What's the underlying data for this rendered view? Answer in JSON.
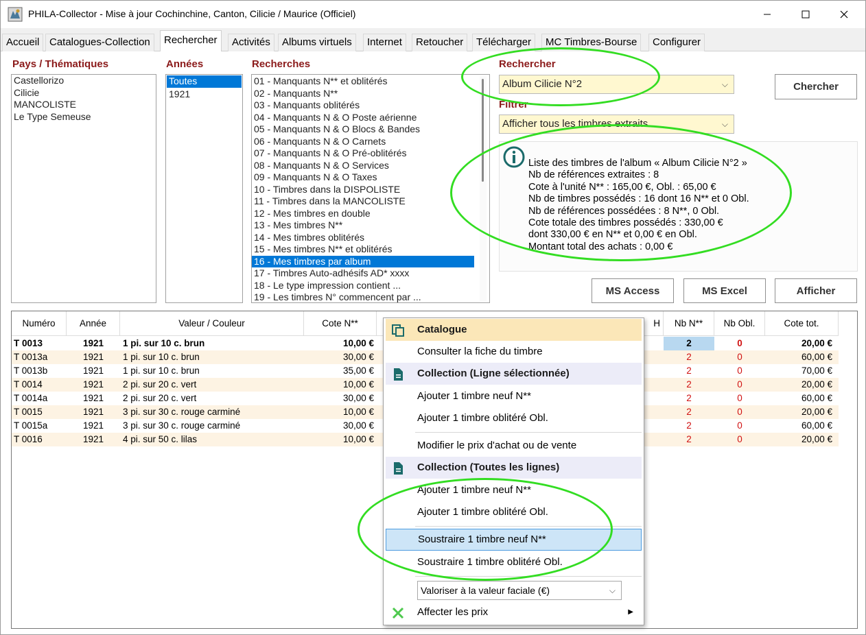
{
  "window": {
    "title": "PHILA-Collector - Mise à jour Cochinchine, Canton, Cilicie / Maurice (Officiel)"
  },
  "tabs": [
    {
      "label": "Accueil"
    },
    {
      "label": "Catalogues-Collection"
    },
    {
      "label": "Rechercher"
    },
    {
      "label": "Activités"
    },
    {
      "label": "Albums virtuels"
    },
    {
      "label": "Internet"
    },
    {
      "label": "Retoucher"
    },
    {
      "label": "Télécharger"
    },
    {
      "label": "MC Timbres-Bourse"
    },
    {
      "label": "Configurer"
    }
  ],
  "filters": {
    "pays_label": "Pays / Thématiques",
    "pays": [
      "Castellorizo",
      "Cilicie",
      "MANCOLISTE",
      "Le Type Semeuse"
    ],
    "annees_label": "Années",
    "annees": [
      "Toutes",
      "1921"
    ],
    "recherches_label": "Recherches",
    "recherches": [
      "01 - Manquants N** et oblitérés",
      "02 - Manquants N**",
      "03 - Manquants oblitérés",
      "04 - Manquants N & O Poste aérienne",
      "05 - Manquants N & O Blocs & Bandes",
      "06 - Manquants N & O Carnets",
      "07 - Manquants N & O Pré-oblitérés",
      "08 - Manquants N & O Services",
      "09 - Manquants N & O Taxes",
      "10 - Timbres dans la DISPOLISTE",
      "11 - Timbres dans la MANCOLISTE",
      "12 - Mes timbres en double",
      "13 - Mes timbres N**",
      "14 - Mes timbres oblitérés",
      "15 - Mes timbres N** et oblitérés",
      "16 - Mes timbres par album",
      "17 - Timbres Auto-adhésifs AD* xxxx",
      "18 - Le type impression contient ...",
      "19 - Les timbres N° commencent par ..."
    ],
    "rechercher_label": "Rechercher",
    "rechercher_value": "Album Cilicie N°2",
    "filtrer_label": "Filtrer",
    "filtrer_value": "Afficher tous les timbres extraits"
  },
  "buttons": {
    "chercher": "Chercher",
    "ms_access": "MS Access",
    "ms_excel": "MS Excel",
    "afficher": "Afficher"
  },
  "info": {
    "lines": [
      "Liste des timbres de l'album « Album Cilicie N°2 »",
      "Nb de références extraites : 8",
      "Cote à l'unité N** : 165,00 €, Obl. : 65,00 €",
      "Nb de timbres possédés : 16 dont 16 N** et 0 Obl.",
      "Nb de références possédées : 8 N**, 0 Obl.",
      "Cote totale des timbres possédés : 330,00 €",
      "dont 330,00 € en N** et 0,00 € en Obl.",
      "Montant total des achats : 0,00 €"
    ]
  },
  "grid": {
    "headers": {
      "numero": "Numéro",
      "annee": "Année",
      "valeur": "Valeur / Couleur",
      "cote_n": "Cote N**",
      "h_partial": "H",
      "nb_n": "Nb N**",
      "nb_obl": "Nb Obl.",
      "cote_tot": "Cote tot."
    },
    "rows": [
      {
        "numero": "T 0013",
        "annee": "1921",
        "valeur": "1 pi. sur 10 c. brun",
        "cote": "10,00 €",
        "nb_n": "2",
        "nb_obl": "0",
        "tot": "20,00 €"
      },
      {
        "numero": "T 0013a",
        "annee": "1921",
        "valeur": "1 pi. sur 10 c. brun",
        "cote": "30,00 €",
        "nb_n": "2",
        "nb_obl": "0",
        "tot": "60,00 €"
      },
      {
        "numero": "T 0013b",
        "annee": "1921",
        "valeur": "1 pi. sur 10 c. brun",
        "cote": "35,00 €",
        "nb_n": "2",
        "nb_obl": "0",
        "tot": "70,00 €"
      },
      {
        "numero": "T 0014",
        "annee": "1921",
        "valeur": "2 pi. sur 20 c. vert",
        "cote": "10,00 €",
        "nb_n": "2",
        "nb_obl": "0",
        "tot": "20,00 €"
      },
      {
        "numero": "T 0014a",
        "annee": "1921",
        "valeur": "2 pi. sur 20 c. vert",
        "cote": "30,00 €",
        "nb_n": "2",
        "nb_obl": "0",
        "tot": "60,00 €"
      },
      {
        "numero": "T 0015",
        "annee": "1921",
        "valeur": "3 pi. sur 30 c. rouge carminé",
        "cote": "10,00 €",
        "nb_n": "2",
        "nb_obl": "0",
        "tot": "20,00 €"
      },
      {
        "numero": "T 0015a",
        "annee": "1921",
        "valeur": "3 pi. sur 30 c. rouge carminé",
        "cote": "30,00 €",
        "nb_n": "2",
        "nb_obl": "0",
        "tot": "60,00 €"
      },
      {
        "numero": "T 0016",
        "annee": "1921",
        "valeur": "4 pi. sur 50 c. lilas",
        "cote": "10,00 €",
        "nb_n": "2",
        "nb_obl": "0",
        "tot": "20,00 €"
      }
    ]
  },
  "context_menu": {
    "catalogue": "Catalogue",
    "consulter": "Consulter la fiche du timbre",
    "collection_sel": "Collection (Ligne sélectionnée)",
    "ajouter_neuf_1": "Ajouter 1 timbre neuf N**",
    "ajouter_obl_1": "Ajouter 1 timbre oblitéré Obl.",
    "modifier_prix": "Modifier le prix d'achat ou de vente",
    "collection_all": "Collection (Toutes les lignes)",
    "ajouter_neuf_2": "Ajouter 1 timbre neuf N**",
    "ajouter_obl_2": "Ajouter 1 timbre oblitéré Obl.",
    "soustraire_neuf": "Soustraire 1 timbre neuf N**",
    "soustraire_obl": "Soustraire 1 timbre oblitéré Obl.",
    "valoriser": "Valoriser à la valeur faciale (€)",
    "affecter": "Affecter les prix"
  },
  "colors": {
    "accent_red": "#8b1a1a",
    "selection_blue": "#0078d7",
    "highlight_green": "#33dd22",
    "row_alt": "#fdf3e3",
    "combo_yellow": "#fff8d0"
  }
}
